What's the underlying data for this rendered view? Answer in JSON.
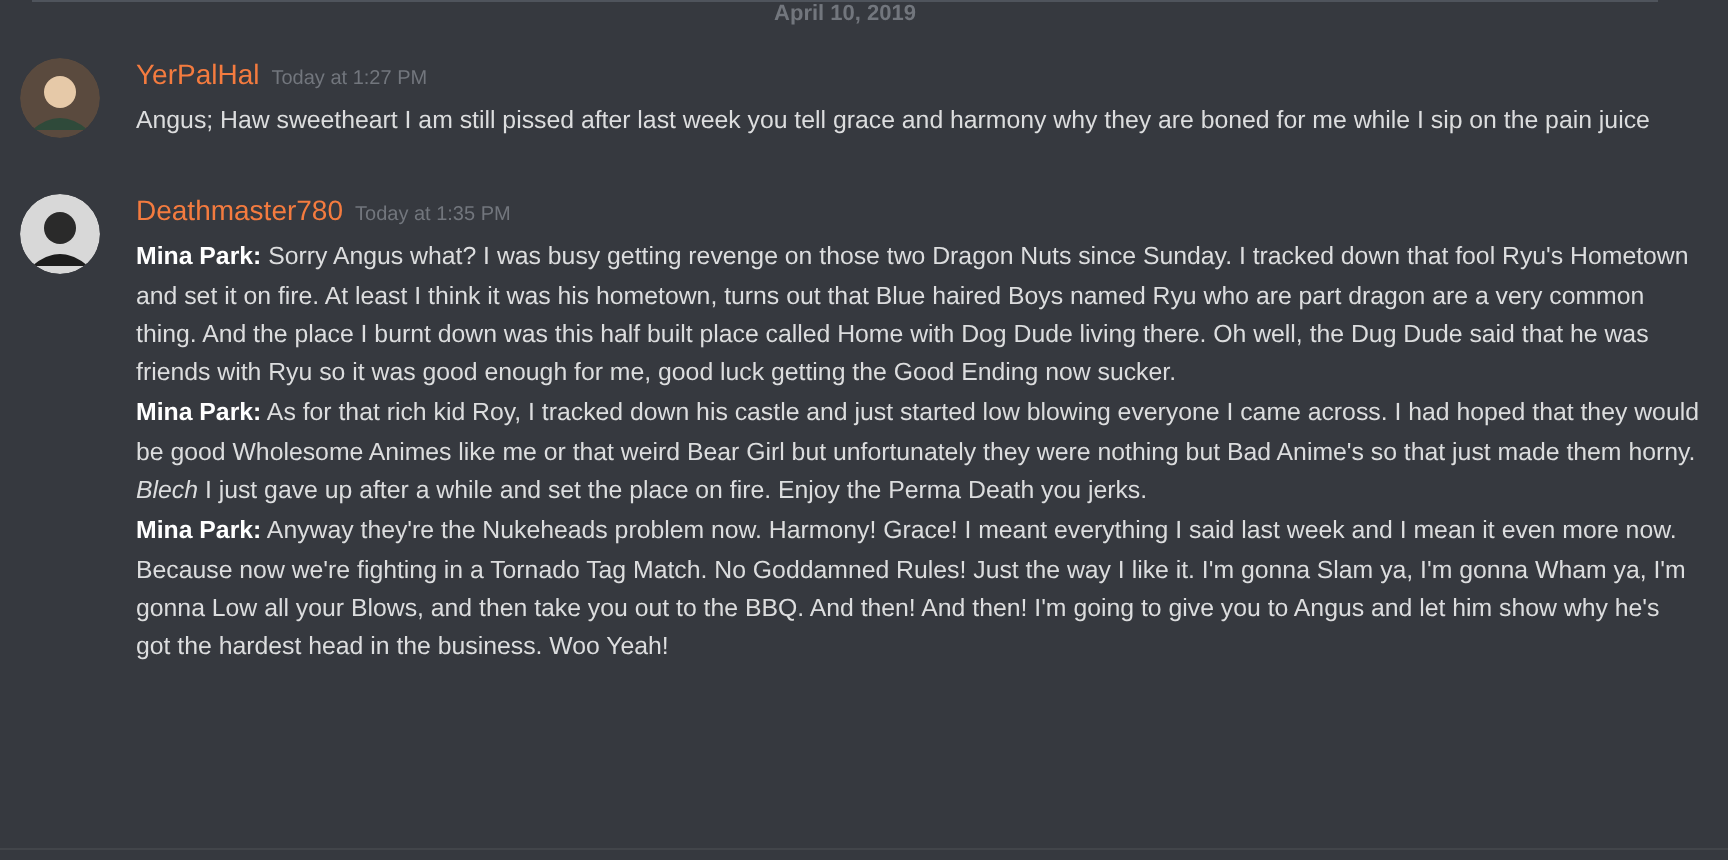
{
  "divider": {
    "label": "April 10, 2019"
  },
  "messages": [
    {
      "author": "YerPalHal",
      "timestamp": "Today at 1:27 PM",
      "paragraphs": [
        "Angus; Haw sweetheart I am still pissed after last week you tell grace and harmony why they are boned for me while I sip on the pain juice"
      ]
    },
    {
      "author": "Deathmaster780",
      "timestamp": "Today at 1:35 PM",
      "paragraphs": [
        "**Mina Park:** Sorry Angus what? I was busy getting revenge on those two Dragon Nuts since Sunday. I tracked down that fool Ryu's Hometown and set it on fire. At least I think it was his hometown, turns out that Blue haired Boys named Ryu who are part dragon are a very common thing. And the place I burnt down was this half built place called Home with Dog Dude living there. Oh well, the Dug Dude said that he was friends with Ryu so it was good enough for me, good luck getting the Good Ending now sucker.",
        "**Mina Park:** As for that rich kid Roy, I tracked down his castle and just started low blowing everyone I came across. I had hoped that they would be good Wholesome Animes like me or that weird Bear Girl but unfortunately they were nothing but Bad Anime's so that just made them horny. *Blech* I just gave up after a while and set the place on fire. Enjoy the Perma Death you jerks.",
        "**Mina Park:** Anyway they're the Nukeheads problem now. Harmony! Grace! I meant everything I said last week and I mean it even more now. Because now we're fighting in a Tornado Tag Match. No Goddamned Rules! Just the way I like it. I'm gonna Slam ya, I'm gonna Wham ya, I'm gonna Low all your Blows, and then take you out to the BBQ. And then! And then! I'm going to give you to Angus and let him show why he's got the hardest head in the business. Woo Yeah!"
      ]
    }
  ]
}
